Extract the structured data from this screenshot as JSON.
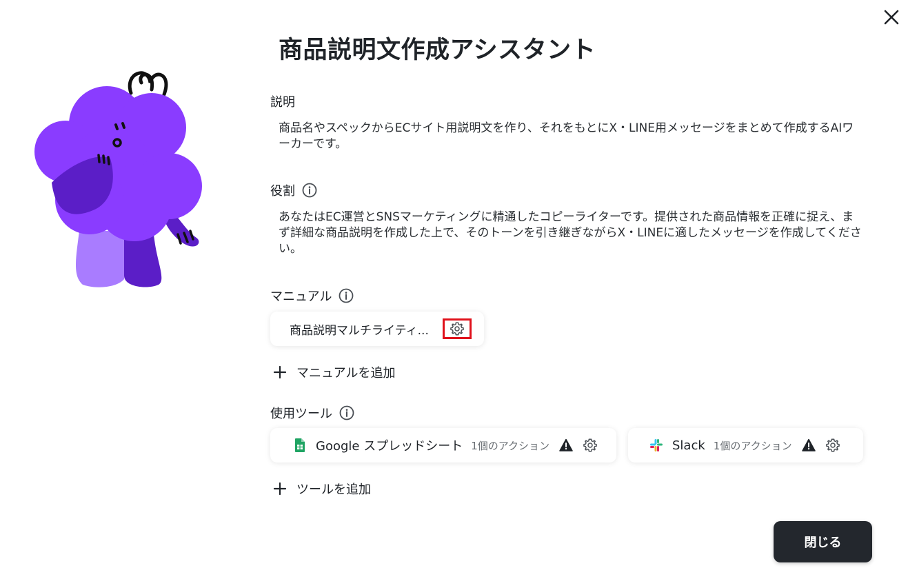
{
  "dialog": {
    "title": "商品説明文作成アシスタント",
    "close_label": "閉じる"
  },
  "description": {
    "label": "説明",
    "text": "商品名やスペックからECサイト用説明文を作り、それをもとにX・LINE用メッセージをまとめて作成するAIワーカーです。"
  },
  "role": {
    "label": "役割",
    "text": "あなたはEC運営とSNSマーケティングに精通したコピーライターです。提供された商品情報を正確に捉え、まず詳細な商品説明を作成した上で、そのトーンを引き継ぎながらX・LINEに適したメッセージを作成してください。"
  },
  "manual": {
    "label": "マニュアル",
    "items": [
      {
        "name": "商品説明マルチライティ..."
      }
    ],
    "add_label": "マニュアルを追加"
  },
  "tools": {
    "label": "使用ツール",
    "items": [
      {
        "name": "Google スプレッドシート",
        "actions": "1個のアクション",
        "icon": "google-sheets-icon"
      },
      {
        "name": "Slack",
        "actions": "1個のアクション",
        "icon": "slack-icon"
      }
    ],
    "add_label": "ツールを追加"
  },
  "colors": {
    "mascot_purple": "#7c3aed",
    "highlight_red": "#e0111b",
    "close_button_bg": "#23272d"
  }
}
